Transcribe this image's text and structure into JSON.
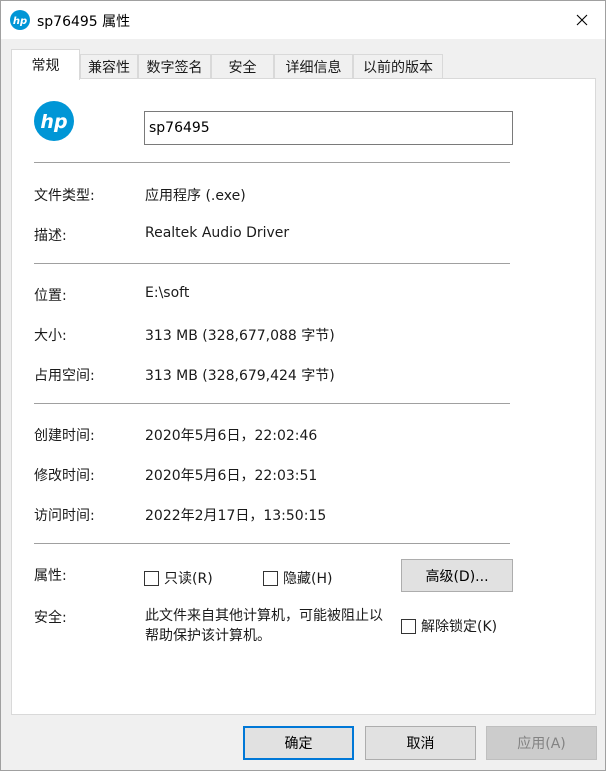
{
  "window": {
    "title": "sp76495 属性"
  },
  "tabs": [
    {
      "label": "常规"
    },
    {
      "label": "兼容性"
    },
    {
      "label": "数字签名"
    },
    {
      "label": "安全"
    },
    {
      "label": "详细信息"
    },
    {
      "label": "以前的版本"
    }
  ],
  "general": {
    "file_name": "sp76495",
    "file_type_label": "文件类型:",
    "file_type_value": "应用程序 (.exe)",
    "description_label": "描述:",
    "description_value": "Realtek Audio Driver",
    "location_label": "位置:",
    "location_value": "E:\\soft",
    "size_label": "大小:",
    "size_value": "313 MB (328,677,088 字节)",
    "size_on_disk_label": "占用空间:",
    "size_on_disk_value": "313 MB (328,679,424 字节)",
    "created_label": "创建时间:",
    "created_value": "2020年5月6日，22:02:46",
    "modified_label": "修改时间:",
    "modified_value": "2020年5月6日，22:03:51",
    "accessed_label": "访问时间:",
    "accessed_value": "2022年2月17日，13:50:15",
    "attributes_label": "属性:",
    "readonly_label": "只读(R)",
    "hidden_label": "隐藏(H)",
    "advanced_label": "高级(D)...",
    "security_label": "安全:",
    "security_text": "此文件来自其他计算机，可能被阻止以帮助保护该计算机。",
    "unblock_label": "解除锁定(K)"
  },
  "footer": {
    "ok_label": "确定",
    "cancel_label": "取消",
    "apply_label": "应用(A)"
  },
  "icons": {
    "app_icon": "hp-logo-icon",
    "close": "close-icon"
  },
  "colors": {
    "hp_blue": "#0096d6",
    "focus_blue": "#0078d7"
  }
}
